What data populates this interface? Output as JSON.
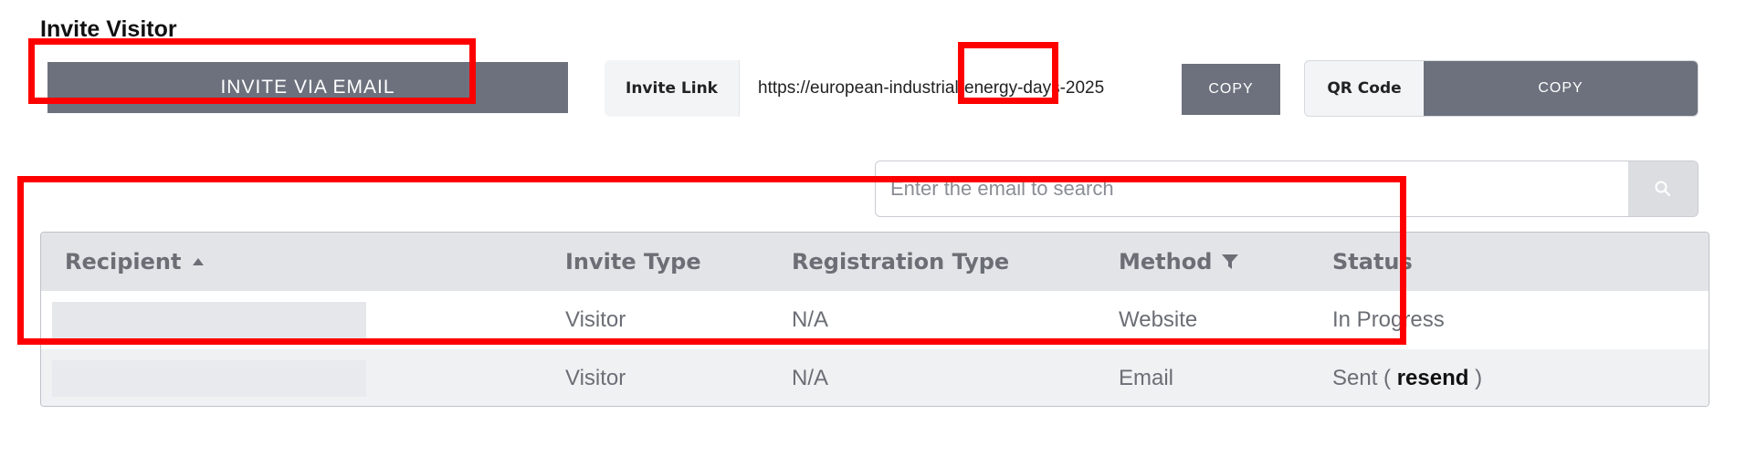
{
  "section": {
    "title": "Invite Visitor"
  },
  "buttons": {
    "invite_email": "INVITE VIA EMAIL",
    "copy_link": "COPY",
    "copy_qr": "COPY"
  },
  "invite_link": {
    "label": "Invite Link",
    "value": "https://european-industrial-energy-days-2025"
  },
  "qr": {
    "label": "QR Code"
  },
  "search": {
    "placeholder": "Enter the email to search"
  },
  "table": {
    "columns": {
      "recipient": "Recipient",
      "invite_type": "Invite Type",
      "registration_type": "Registration Type",
      "method": "Method",
      "status": "Status"
    },
    "rows": [
      {
        "invite_type": "Visitor",
        "registration_type": "N/A",
        "method": "Website",
        "status": "In Progress"
      },
      {
        "invite_type": "Visitor",
        "registration_type": "N/A",
        "method": "Email",
        "status_prefix": "Sent (",
        "status_action": "resend",
        "status_suffix": ")"
      }
    ]
  },
  "icons": {
    "search": "search-icon",
    "sort": "caret-up-icon",
    "filter": "filter-icon"
  },
  "colors": {
    "button_bg": "#6c717d",
    "highlight": "#ff0000",
    "header_bg": "#e3e4e8",
    "muted_text": "#6b6e75"
  }
}
